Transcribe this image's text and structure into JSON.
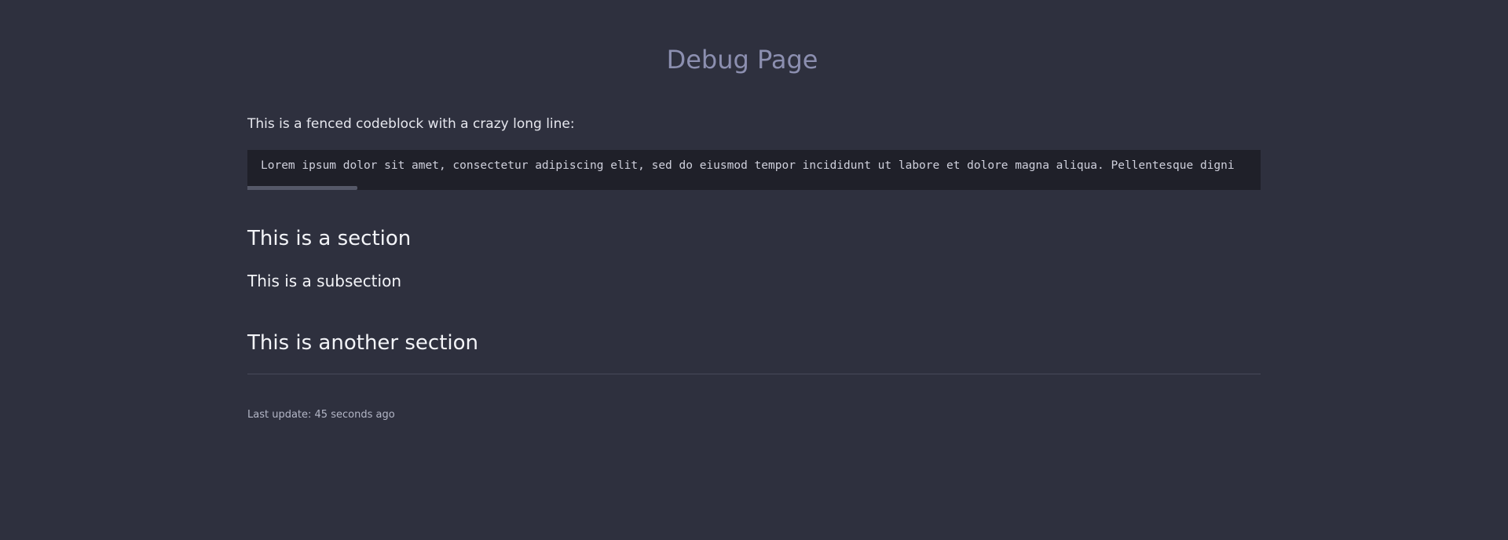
{
  "page": {
    "title": "Debug Page",
    "intro": "This is a fenced codeblock with a crazy long line:",
    "code": "Lorem ipsum dolor sit amet, consectetur adipiscing elit, sed do eiusmod tempor incididunt ut labore et dolore magna aliqua. Pellentesque digni",
    "sections": [
      {
        "heading": "This is a section"
      },
      {
        "subheading": "This is a subsection"
      },
      {
        "heading": "This is another section"
      }
    ],
    "footer": {
      "last_update": "Last update: 45 seconds ago"
    }
  },
  "colors": {
    "background": "#2e303e",
    "title": "#8c8fb0",
    "code_background": "#1f2029",
    "text": "#e6e7ee"
  }
}
